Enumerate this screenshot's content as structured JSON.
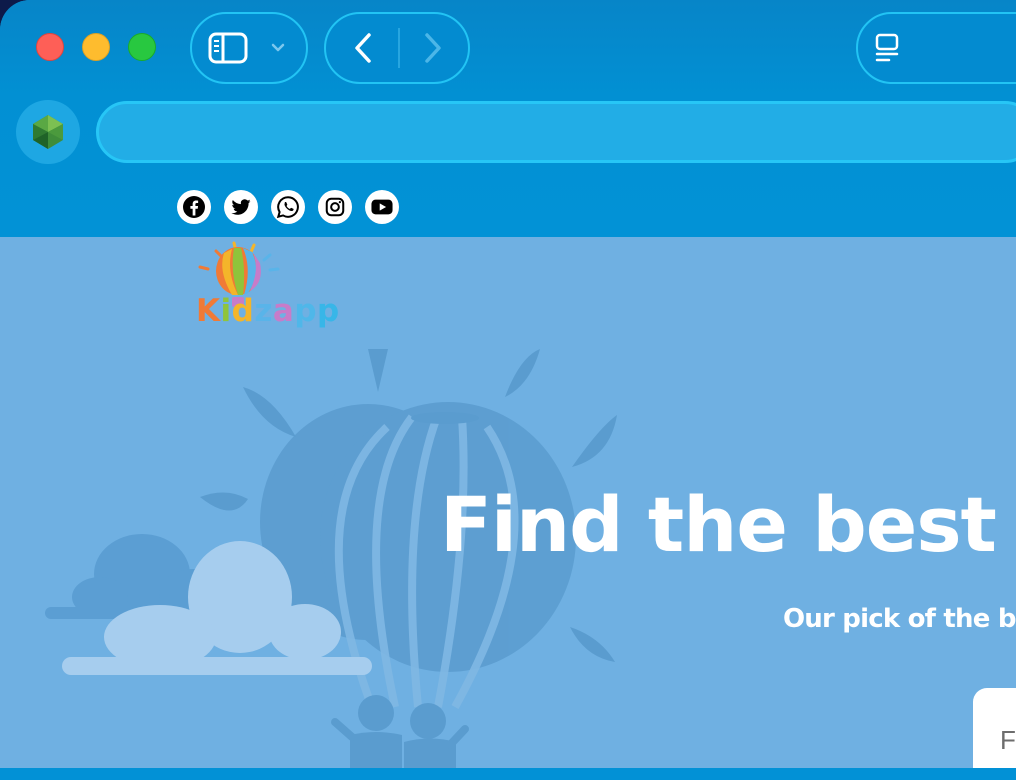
{
  "browser": {
    "window_controls": {
      "close": "close-window",
      "minimize": "minimize-window",
      "zoom": "zoom-window"
    },
    "toolbar": {
      "sidebar_icon": "sidebar-icon",
      "sidebar_menu_icon": "chevron-down-icon",
      "back_icon": "chevron-left-icon",
      "forward_icon": "chevron-right-icon",
      "tab_overview_icon": "tab-overview-icon"
    },
    "address_bar": {
      "value": "",
      "placeholder": ""
    },
    "privacy_icon": "shield-icon"
  },
  "social_links": [
    {
      "name": "facebook",
      "icon": "facebook-icon"
    },
    {
      "name": "twitter",
      "icon": "twitter-icon"
    },
    {
      "name": "whatsapp",
      "icon": "whatsapp-icon"
    },
    {
      "name": "instagram",
      "icon": "instagram-icon"
    },
    {
      "name": "youtube",
      "icon": "youtube-icon"
    }
  ],
  "logo": {
    "text": "Kidzapp",
    "letters": [
      "K",
      "i",
      "d",
      "z",
      "a",
      "p",
      "p"
    ],
    "letter_colors": [
      "#f07a36",
      "#8fc43b",
      "#f4b52a",
      "#59b4e9",
      "#c77cc9",
      "#4fb7e9",
      "#38b6e8"
    ]
  },
  "hero": {
    "title": "Find the best p",
    "subtitle": "Our pick of the be",
    "search_card_text": "Fi"
  },
  "colors": {
    "chrome_blue": "#0290d3",
    "page_background": "#6fb0e2",
    "address_bar": "#22ade6"
  }
}
